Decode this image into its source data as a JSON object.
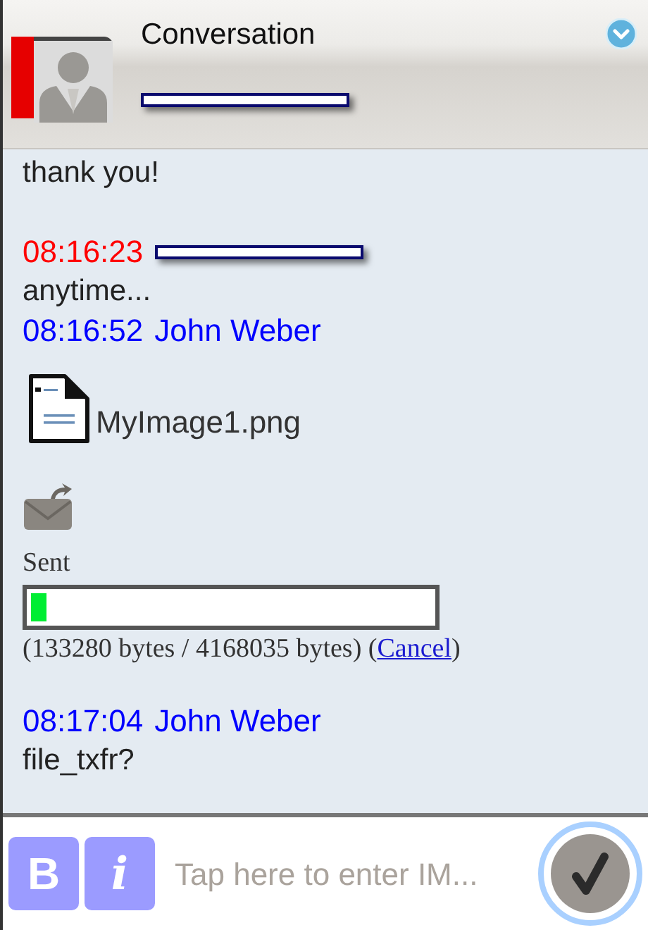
{
  "header": {
    "title": "Conversation",
    "subtitle_redacted": true
  },
  "messages": [
    {
      "kind": "text",
      "text": "thank  you!"
    },
    {
      "kind": "header",
      "time": "08:16:23",
      "redacted": true,
      "color": "#ff0000"
    },
    {
      "kind": "text",
      "text": "anytime..."
    },
    {
      "kind": "header",
      "time": "08:16:52",
      "redacted": false,
      "name": "John Weber",
      "color": "#0000ff"
    },
    {
      "kind": "file",
      "name": "MyImage1.png"
    },
    {
      "kind": "transfer",
      "status": "Sent",
      "level": 0.04,
      "before": "(133280 bytes / 4168035 bytes) (",
      "link": "Cancel",
      "after": ")"
    },
    {
      "kind": "header",
      "time": "08:17:04",
      "redacted": false,
      "name": "John Weber",
      "color": "#0000ff"
    },
    {
      "kind": "text",
      "text": "file_txfr?"
    }
  ],
  "composer": {
    "bold_label": "B",
    "italic_label": "i",
    "placeholder": "Tap here to enter IM..."
  }
}
